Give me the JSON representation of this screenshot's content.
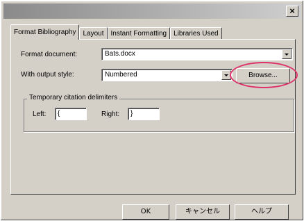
{
  "window": {
    "title": "",
    "close_glyph": "×"
  },
  "tabs": [
    {
      "label": "Format Bibliography",
      "active": true
    },
    {
      "label": "Layout",
      "active": false
    },
    {
      "label": "Instant Formatting",
      "active": false
    },
    {
      "label": "Libraries Used",
      "active": false
    }
  ],
  "form": {
    "format_document_label": "Format document:",
    "format_document_value": "Bats.docx",
    "output_style_label": "With output style:",
    "output_style_value": "Numbered",
    "browse_label": "Browse..."
  },
  "delimiters": {
    "group_title": "Temporary citation delimiters",
    "left_label": "Left:",
    "left_value": "{",
    "right_label": "Right:",
    "right_value": "}"
  },
  "buttons": {
    "ok": "OK",
    "cancel": "キャンセル",
    "help": "ヘルプ"
  },
  "colors": {
    "dialog_face": "#d4d0c8",
    "highlight": "#e0306a"
  }
}
